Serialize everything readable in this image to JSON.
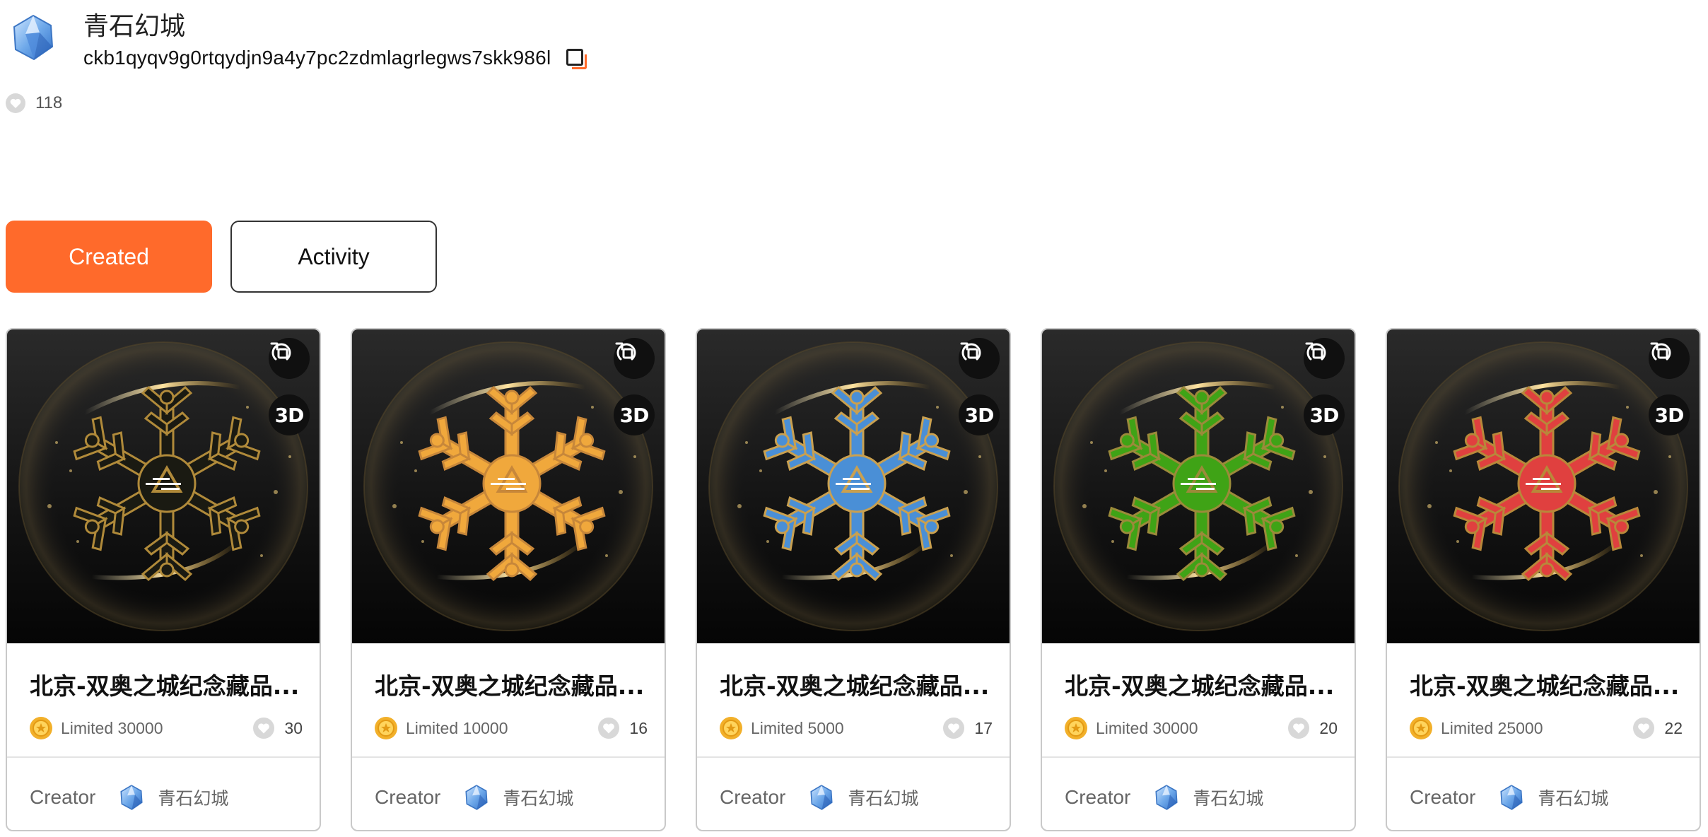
{
  "profile": {
    "name": "青石幻城",
    "address": "ckb1qyqv9g0rtqydjn9a4y7pc2zdmlagrlegws7skk986l",
    "likes": "118"
  },
  "tabs": [
    {
      "label": "Created",
      "active": true
    },
    {
      "label": "Activity",
      "active": false
    }
  ],
  "colors": {
    "accent": "#ff6a2b"
  },
  "badges": {
    "rotate_icon": "rotate-icon",
    "three_d": "3D"
  },
  "cards": [
    {
      "title": "北京-双奥之城纪念藏品...",
      "limited": "Limited 30000",
      "likes": "30",
      "creator_label": "Creator",
      "creator_name": "青石幻城",
      "snowflake_color": "#1a1a12",
      "snowflake_outline": "#b08a3a"
    },
    {
      "title": "北京-双奥之城纪念藏品...",
      "limited": "Limited 10000",
      "likes": "16",
      "creator_label": "Creator",
      "creator_name": "青石幻城",
      "snowflake_color": "#f0a83c",
      "snowflake_outline": "#c7873a"
    },
    {
      "title": "北京-双奥之城纪念藏品...",
      "limited": "Limited 5000",
      "likes": "17",
      "creator_label": "Creator",
      "creator_name": "青石幻城",
      "snowflake_color": "#4a8fd6",
      "snowflake_outline": "#c9a050"
    },
    {
      "title": "北京-双奥之城纪念藏品...",
      "limited": "Limited 30000",
      "likes": "20",
      "creator_label": "Creator",
      "creator_name": "青石幻城",
      "snowflake_color": "#3fa316",
      "snowflake_outline": "#9b8a3a"
    },
    {
      "title": "北京-双奥之城纪念藏品...",
      "limited": "Limited 25000",
      "likes": "22",
      "creator_label": "Creator",
      "creator_name": "青石幻城",
      "snowflake_color": "#e0403f",
      "snowflake_outline": "#b8883a"
    }
  ]
}
